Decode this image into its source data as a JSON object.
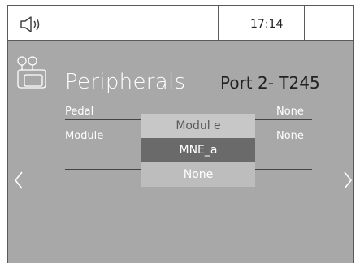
{
  "status": {
    "time": "17:14"
  },
  "screen": {
    "title": "Peripherals",
    "port": "Port 2- T245"
  },
  "rows": [
    {
      "label": "Pedal",
      "value": "None"
    },
    {
      "label": "Module",
      "value": "None"
    }
  ],
  "picker": {
    "options": [
      "Modul e",
      "MNE_a",
      "None"
    ],
    "selected": "MNE_a"
  },
  "icons": {
    "speaker": "speaker-icon",
    "peripherals": "peripherals-icon",
    "left": "chevron-left-icon",
    "right": "chevron-right-icon"
  }
}
